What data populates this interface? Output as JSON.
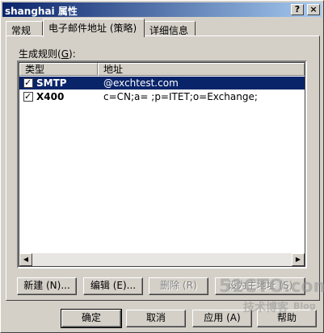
{
  "window": {
    "title": "shanghai 属性"
  },
  "titlebar_buttons": {
    "help": "?",
    "close": "×"
  },
  "tabs": [
    "常规",
    "电子邮件地址 (策略)",
    "详细信息"
  ],
  "generation_rules": {
    "label": "生成规则",
    "mnemonic": "G",
    "suffix": ":"
  },
  "table": {
    "columns": [
      "类型",
      "地址"
    ],
    "rows": [
      {
        "type": "SMTP",
        "address": "@exchtest.com",
        "checked": true,
        "selected": true
      },
      {
        "type": "X400",
        "address": "c=CN;a= ;p=ITET;o=Exchange;",
        "checked": true,
        "selected": false
      }
    ]
  },
  "actions": {
    "new": "新建 (N)...",
    "edit": "编辑 (E)...",
    "remove": "删除 (R)",
    "set_primary": "设为主地址 (S)"
  },
  "footer": {
    "ok": "确定",
    "cancel": "取消",
    "apply": "应用 (A)",
    "help": "帮助"
  },
  "watermarks": [
    "51CTO.com",
    "技术博客",
    "Blog"
  ]
}
